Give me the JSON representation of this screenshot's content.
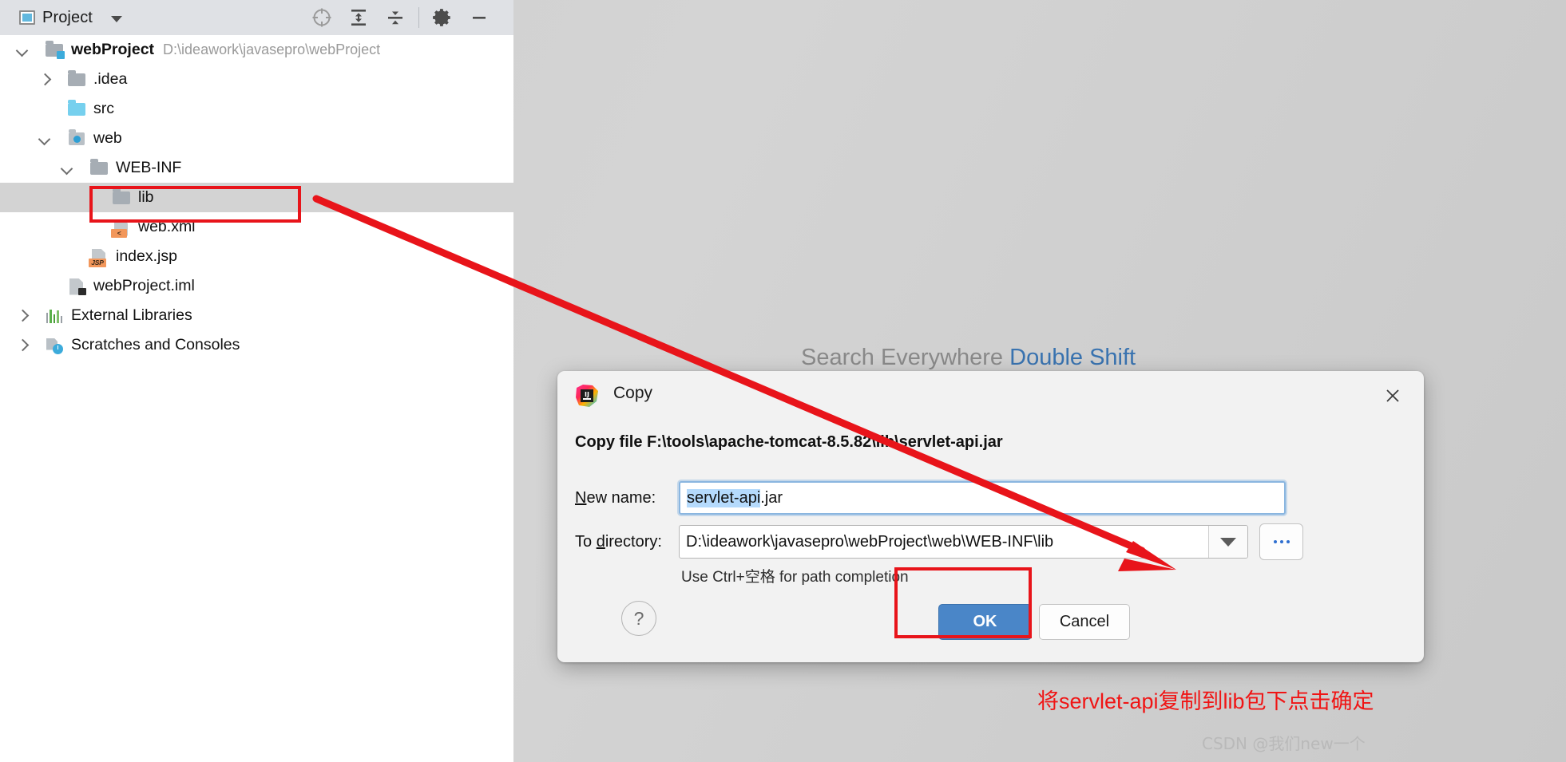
{
  "toolwindow": {
    "title": "Project",
    "dropdown_icon": "chevron-down-icon",
    "actions": [
      {
        "name": "locate-icon",
        "label": "Select Opened File"
      },
      {
        "name": "expand-all-icon",
        "label": "Expand All"
      },
      {
        "name": "collapse-all-icon",
        "label": "Collapse All"
      },
      {
        "name": "gear-icon",
        "label": "Options"
      },
      {
        "name": "minimize-icon",
        "label": "Hide"
      }
    ]
  },
  "tree": {
    "nodes": [
      {
        "label": "webProject",
        "path": "D:\\ideawork\\javasepro\\webProject",
        "icon": "module-folder-icon",
        "twisty": "down",
        "indent": 0,
        "bold": true,
        "selected": false
      },
      {
        "label": ".idea",
        "path": "",
        "icon": "folder-icon",
        "twisty": "right",
        "indent": 1,
        "bold": false,
        "selected": false
      },
      {
        "label": "src",
        "path": "",
        "icon": "source-folder-icon",
        "twisty": "none",
        "indent": 1,
        "bold": false,
        "selected": false
      },
      {
        "label": "web",
        "path": "",
        "icon": "web-folder-icon",
        "twisty": "down",
        "indent": 1,
        "bold": false,
        "selected": false
      },
      {
        "label": "WEB-INF",
        "path": "",
        "icon": "folder-icon",
        "twisty": "down",
        "indent": 2,
        "bold": false,
        "selected": false
      },
      {
        "label": "lib",
        "path": "",
        "icon": "folder-icon",
        "twisty": "none",
        "indent": 3,
        "bold": false,
        "selected": true
      },
      {
        "label": "web.xml",
        "path": "",
        "icon": "xml-file-icon",
        "twisty": "none",
        "indent": 3,
        "bold": false,
        "selected": false
      },
      {
        "label": "index.jsp",
        "path": "",
        "icon": "jsp-file-icon",
        "twisty": "none",
        "indent": 2,
        "bold": false,
        "selected": false
      },
      {
        "label": "webProject.iml",
        "path": "",
        "icon": "iml-file-icon",
        "twisty": "none",
        "indent": 1,
        "bold": false,
        "selected": false
      },
      {
        "label": "External Libraries",
        "path": "",
        "icon": "libraries-icon",
        "twisty": "right",
        "indent": 0,
        "bold": false,
        "selected": false
      },
      {
        "label": "Scratches and Consoles",
        "path": "",
        "icon": "scratches-icon",
        "twisty": "right",
        "indent": 0,
        "bold": false,
        "selected": false
      }
    ],
    "badges": {
      "xml": "<",
      "jsp": "JSP"
    }
  },
  "editor_hint": {
    "action": "Search Everywhere",
    "shortcut": "Double Shift"
  },
  "dialog": {
    "icon": "intellij-idea-icon",
    "title": "Copy",
    "close_icon": "close-icon",
    "header": "Copy file F:\\tools\\apache-tomcat-8.5.82\\lib\\servlet-api.jar",
    "new_name": {
      "label_prefix": "N",
      "label_rest": "ew name:",
      "value_selected": "servlet-api",
      "value_rest": ".jar"
    },
    "to_directory": {
      "label_prefix": "To ",
      "label_underlined": "d",
      "label_rest": "irectory:",
      "value": "D:\\ideawork\\javasepro\\webProject\\web\\WEB-INF\\lib",
      "dropdown_icon": "chevron-down-icon",
      "browse_label": "..."
    },
    "completion_hint": "Use Ctrl+空格 for path completion",
    "help_label": "?",
    "ok_label": "OK",
    "cancel_label": "Cancel"
  },
  "annotation": {
    "text": "将servlet-api复制到lib包下点击确定",
    "color": "#f01414",
    "arrow_color": "#e8141a"
  },
  "watermark": "CSDN @我们new一个",
  "colors": {
    "accent_blue": "#4a86c8",
    "highlight_red": "#e8141a",
    "selection_blue": "#b5dafc",
    "toolbar_bg": "#dfe1e5",
    "row_selected": "#d3d3d3"
  }
}
